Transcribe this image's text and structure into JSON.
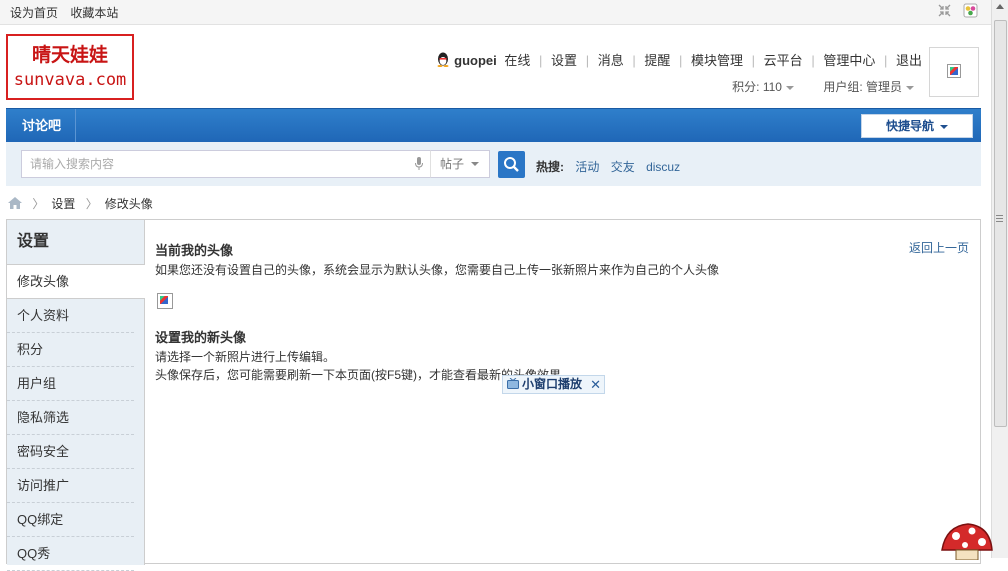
{
  "topbar": {
    "links": [
      "设为首页",
      "收藏本站"
    ]
  },
  "logo": {
    "line1": "晴天娃娃",
    "line2": "sunvava.com"
  },
  "user": {
    "name": "guopei",
    "status": "在线",
    "menu": [
      "设置",
      "消息",
      "提醒",
      "模块管理",
      "云平台",
      "管理中心",
      "退出"
    ],
    "score_label": "积分: 110",
    "group_label": "用户组: 管理员"
  },
  "nav": {
    "item": "讨论吧",
    "quick_nav": "快捷导航"
  },
  "search": {
    "placeholder": "请输入搜索内容",
    "type": "帖子",
    "hot_label": "热搜:",
    "hot_items": [
      "活动",
      "交友",
      "discuz"
    ]
  },
  "breadcrumb": {
    "items": [
      "设置",
      "修改头像"
    ]
  },
  "sidebar": {
    "title": "设置",
    "items": [
      "修改头像",
      "个人资料",
      "积分",
      "用户组",
      "隐私筛选",
      "密码安全",
      "访问推广",
      "QQ绑定",
      "QQ秀"
    ]
  },
  "content": {
    "back_link": "返回上一页",
    "current_title": "当前我的头像",
    "current_desc": "如果您还没有设置自己的头像，系统会显示为默认头像，您需要自己上传一张新照片来作为自己的个人头像",
    "new_title": "设置我的新头像",
    "new_desc1": "请选择一个新照片进行上传编辑。",
    "new_desc2": "头像保存后，您可能需要刷新一下本页面(按F5键)，才能查看最新的头像效果"
  },
  "mini_player": {
    "label": "小窗口播放",
    "close": "✕"
  },
  "colors": {
    "nav_blue": "#2f7fcb",
    "link_blue": "#336699",
    "logo_red": "#c81414",
    "sidebar_bg": "#e8eff5"
  }
}
